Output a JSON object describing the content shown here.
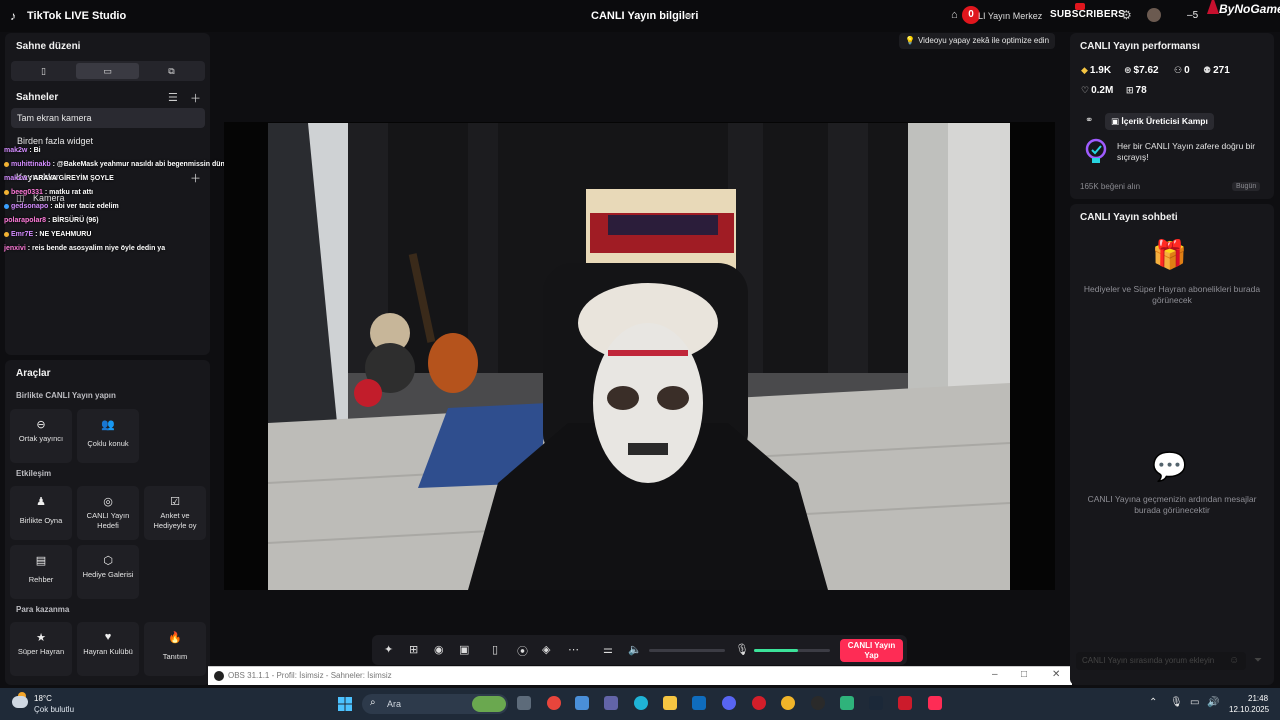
{
  "app": {
    "title": "TikTok LIVE Studio",
    "center_title": "CANLI Yayın bilgileri"
  },
  "overlay_top": {
    "notification_count": "0",
    "live_center": "LI Yayın Merkez",
    "subscribers_label": "SUBSCRIBERS",
    "count": "5",
    "brand": "ByNoGame"
  },
  "left": {
    "scene_layout_title": "Sahne düzeni",
    "scenes_title": "Sahneler",
    "scenes": [
      "Tam ekran kamera",
      "Birden fazla widget"
    ],
    "sources_title": "Kaynaklar",
    "source_item": "Kamera"
  },
  "chat_overlay": [
    {
      "user": "mak2w",
      "msg": ": Bi"
    },
    {
      "user": "muhittinakb",
      "msg": ": @BakeMask yeahmur nasıldı abi begenmissin dün"
    },
    {
      "user": "mak2w",
      "msg": ": ARAYA GİREYİM ŞOYLE"
    },
    {
      "user": "beeg0331",
      "msg": ": matku rat attı"
    },
    {
      "user": "gedsonapo",
      "msg": ": abi ver taciz edelim"
    },
    {
      "user": "polarapolar8",
      "msg": ": BİRSÜRÜ (96)"
    },
    {
      "user": "Emr7E",
      "msg": ": NE YEAHMURU"
    },
    {
      "user": "jenxivi",
      "msg": ": reis bende asosyalim niye öyle dedin ya"
    }
  ],
  "tools": {
    "title": "Araçlar",
    "section_collab": "Birlikte CANLI Yayın yapın",
    "collab_items": [
      "Ortak yayıncı",
      "Çoklu konuk"
    ],
    "section_engage": "Etkileşim",
    "engage_items": [
      "Birlikte Oyna",
      "CANLI Yayın Hedefi",
      "Anket ve Hediyeyle oy",
      "Rehber",
      "Hediye Galerisi"
    ],
    "section_earn": "Para kazanma",
    "earn_items": [
      "Süper Hayran",
      "Hayran Kulübü",
      "Tanıtım"
    ]
  },
  "center": {
    "ai_optimize": "Videoyu yapay zekâ ile optimize edin",
    "go_live": "CANLI Yayın Yap",
    "speaker_volume": 0,
    "mic_volume": 0.58
  },
  "obs": {
    "title": "OBS 31.1.1 - Profil: İsimsiz - Sahneler: İsimsiz"
  },
  "right": {
    "perf_title": "CANLI Yayın performansı",
    "stats": {
      "diamonds": "1.9K",
      "earnings": "$7.62",
      "viewers": "0",
      "followers": "271",
      "likes": "0.2M",
      "gifts": "78"
    },
    "campaign_button": "İçerik Üreticisi Kampı",
    "campaign_text": "Her bir CANLI Yayın zafere doğru bir sıçrayış!",
    "likes_goal": "165K beğeni alın",
    "today": "Bugün",
    "chat_title": "CANLI Yayın sohbeti",
    "gifts_empty": "Hediyeler ve Süper Hayran abonelikleri burada görünecek",
    "chat_empty": "CANLI Yayına geçmenizin ardından mesajlar burada görünecektir",
    "chat_input_placeholder": "CANLI Yayın sırasında yorum ekleyin"
  },
  "taskbar": {
    "temp": "18°C",
    "weather": "Çok bulutlu",
    "search": "Ara",
    "time": "21:48",
    "date": "12.10.2025"
  }
}
